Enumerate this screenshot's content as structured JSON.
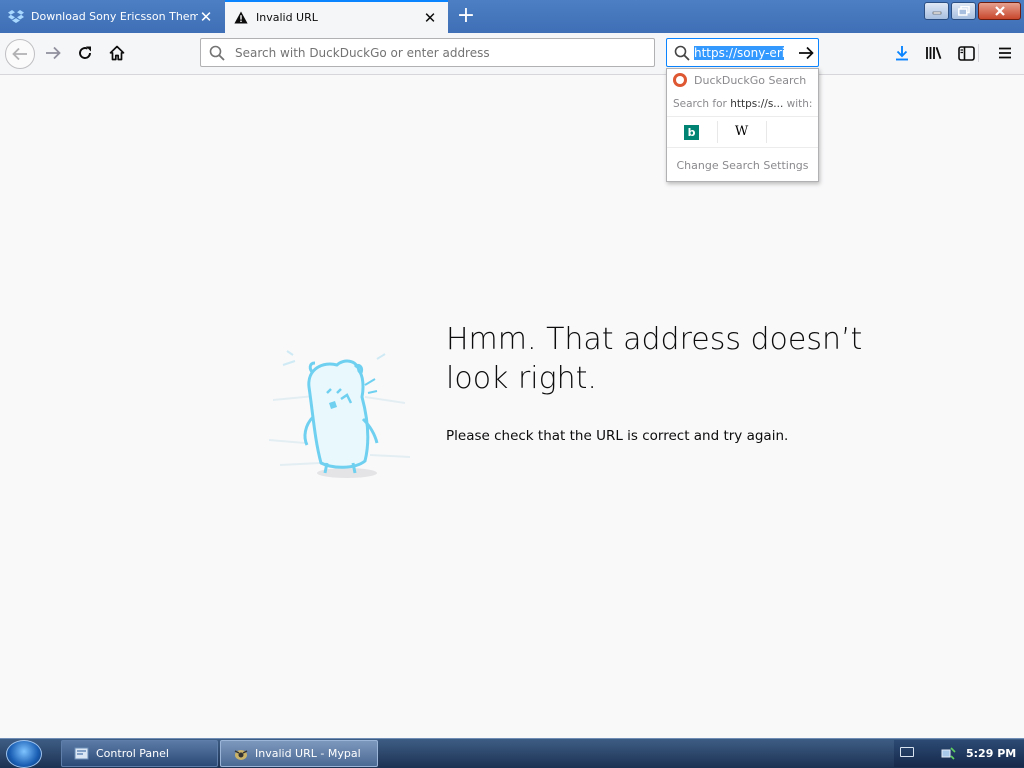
{
  "tabs": [
    {
      "label": "Download Sony Ericsson Theme",
      "icon": "dropbox-icon",
      "active": false
    },
    {
      "label": "Invalid URL",
      "icon": "warning-icon",
      "active": true
    }
  ],
  "navbar": {
    "url_placeholder": "Search with DuckDuckGo or enter address",
    "search_value": "https://sony-eric"
  },
  "search_popup": {
    "engine_label": "DuckDuckGo Search",
    "search_for_prefix": "Search for ",
    "search_for_query": "https://s...",
    "search_for_suffix": " with:",
    "engines": [
      "bing-icon",
      "wikipedia-icon"
    ],
    "wiki_glyph": "W",
    "bing_glyph": "b",
    "change_settings": "Change Search Settings"
  },
  "error": {
    "title": "Hmm. That address doesn’t look right.",
    "description": "Please check that the URL is correct and try again."
  },
  "taskbar": {
    "tasks": [
      {
        "label": "Control Panel",
        "icon": "control-panel-icon"
      },
      {
        "label": "Invalid URL - Mypal",
        "icon": "mypal-icon"
      }
    ],
    "clock": "5:29 PM"
  },
  "colors": {
    "accent": "#0a84ff",
    "tabstrip": "#4c7fc4",
    "page_bg": "#f9f9fa",
    "mascot": "#6fd0f0"
  }
}
